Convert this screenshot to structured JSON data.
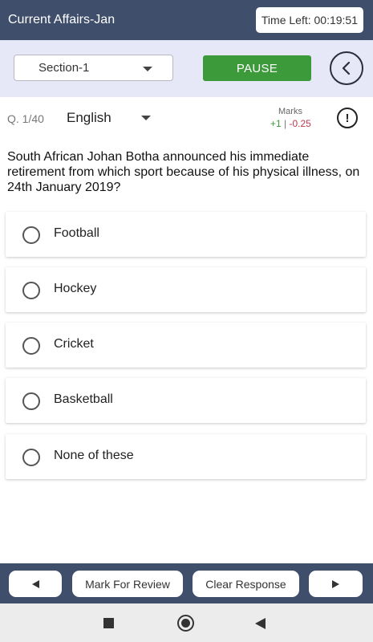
{
  "header": {
    "title": "Current Affairs-Jan",
    "timer": "Time Left: 00:19:51"
  },
  "controls": {
    "section": "Section-1",
    "pause_label": "PAUSE",
    "back_icon": "chevron-left-icon"
  },
  "question_info": {
    "number": "Q. 1/40",
    "language": "English",
    "marks_label": "Marks",
    "marks_positive": "+1",
    "marks_separator": " | ",
    "marks_negative": "-0.25",
    "report_icon": "exclamation-icon"
  },
  "question": {
    "text": "South African Johan Botha announced his immediate retirement from which sport because of his physical illness, on 24th January 2019?",
    "options": [
      {
        "label": "Football"
      },
      {
        "label": "Hockey"
      },
      {
        "label": "Cricket"
      },
      {
        "label": "Basketball"
      },
      {
        "label": "None of these"
      }
    ]
  },
  "actions": {
    "prev_icon": "left-triangle-icon",
    "review_label": "Mark For Review",
    "clear_label": "Clear Response",
    "next_icon": "right-triangle-icon"
  },
  "colors": {
    "header_bg": "#3f4e6b",
    "control_bg": "#e6e7f7",
    "pause_green": "#3d9a3a",
    "negative_red": "#c0394b"
  }
}
